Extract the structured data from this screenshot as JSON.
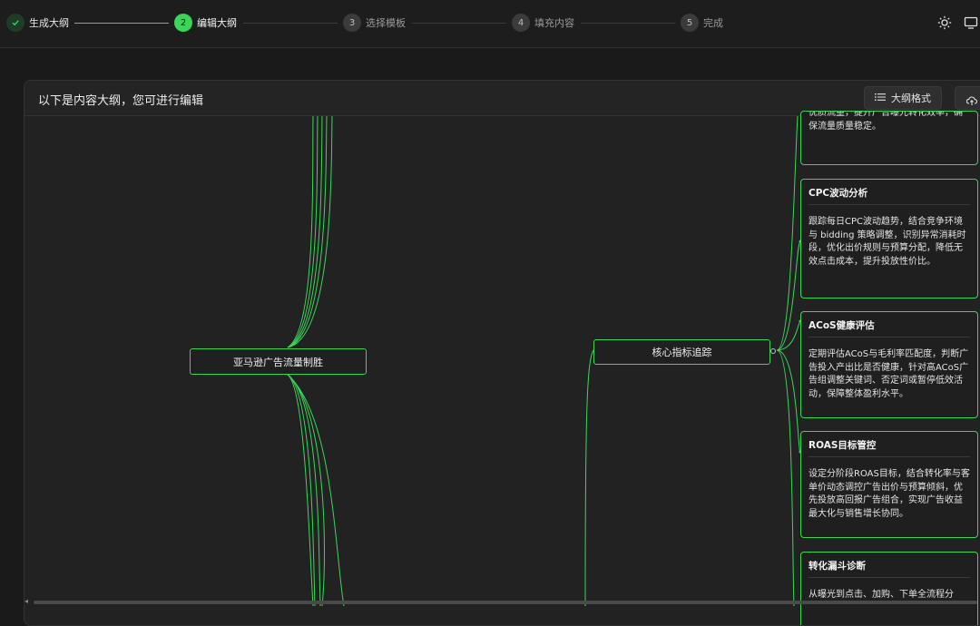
{
  "steps": [
    {
      "number": "✓",
      "label": "生成大纲",
      "state": "done"
    },
    {
      "number": "2",
      "label": "编辑大纲",
      "state": "active"
    },
    {
      "number": "3",
      "label": "选择模板",
      "state": "pending"
    },
    {
      "number": "4",
      "label": "填充内容",
      "state": "pending"
    },
    {
      "number": "5",
      "label": "完成",
      "state": "pending"
    }
  ],
  "toolbar_icons": [
    "sun-icon",
    "monitor-icon"
  ],
  "panel": {
    "title": "以下是内容大纲，您可进行编辑",
    "format_button": "大纲格式",
    "format_icon": "list-icon",
    "export_icon": "cloud-upload-icon"
  },
  "mindmap": {
    "root": "亚马逊广告流量制胜",
    "branch": "核心指标追踪",
    "partial_card_text": "优质流量，提升广告曝光转化效率，确保流量质量稳定。",
    "cards": [
      {
        "title": "CPC波动分析",
        "body": "跟踪每日CPC波动趋势，结合竞争环境与 bidding 策略调整，识别异常消耗时段，优化出价规则与预算分配，降低无效点击成本，提升投放性价比。"
      },
      {
        "title": "ACoS健康评估",
        "body": "定期评估ACoS与毛利率匹配度，判断广告投入产出比是否健康，针对高ACoS广告组调整关键词、否定词或暂停低效活动，保障整体盈利水平。"
      },
      {
        "title": "ROAS目标管控",
        "body": "设定分阶段ROAS目标，结合转化率与客单价动态调控广告出价与预算倾斜，优先投放高回报广告组合，实现广告收益最大化与销售增长协同。"
      },
      {
        "title": "转化漏斗诊断",
        "body": "从曝光到点击、加购、下单全流程分"
      }
    ]
  },
  "colors": {
    "accent": "#3ad65a",
    "background": "#1a1a1a",
    "panel": "#222222"
  }
}
